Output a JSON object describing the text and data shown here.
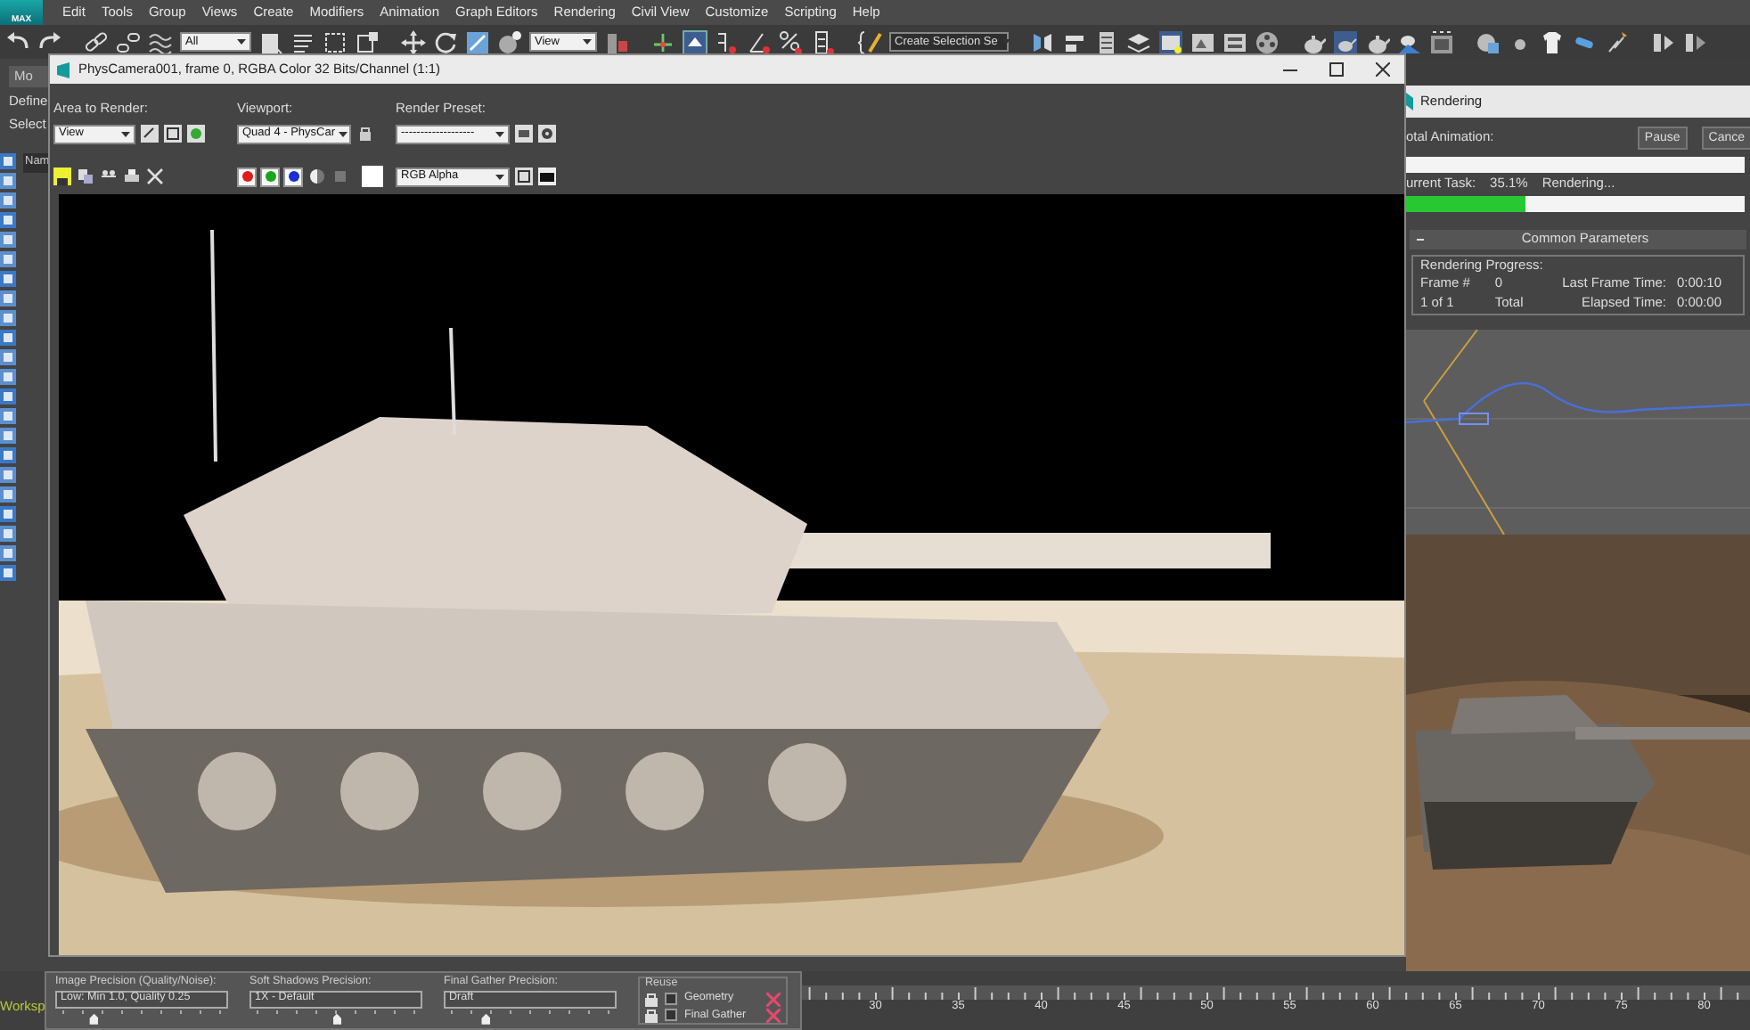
{
  "menu": {
    "logo": "MAX",
    "items": [
      "Edit",
      "Tools",
      "Group",
      "Views",
      "Create",
      "Modifiers",
      "Animation",
      "Graph Editors",
      "Rendering",
      "Civil View",
      "Customize",
      "Scripting",
      "Help"
    ]
  },
  "toolbar": {
    "dropdowns": [
      "All",
      "View",
      "Create Selection Se"
    ]
  },
  "command_panel": {
    "tab": "Mo",
    "rows": [
      "Define",
      "Select"
    ],
    "name_field": "Nam"
  },
  "frame_window": {
    "title": "PhysCamera001, frame 0, RGBA Color 32 Bits/Channel (1:1)",
    "area_label": "Area to Render:",
    "area_value": "View",
    "viewport_label": "Viewport:",
    "viewport_value": "Quad 4 - PhysCar",
    "preset_label": "Render Preset:",
    "preset_value": "-------------------",
    "channels": [
      {
        "color": "#e01b1b",
        "on": true
      },
      {
        "color": "#1aa51a",
        "on": true
      },
      {
        "color": "#1c2fd6",
        "on": true
      }
    ],
    "display_value": "RGB Alpha"
  },
  "rendering_dialog": {
    "title": "Rendering",
    "total_label": "otal Animation:",
    "buttons": [
      "Pause",
      "Cance"
    ],
    "total_progress": {
      "level": 0
    },
    "task_label": "urrent Task:",
    "task_percent": "35.1%",
    "task_status": "Rendering...",
    "task_progress": {
      "level": 0.35
    },
    "rollout": "Common Parameters",
    "group": "Rendering Progress:",
    "frame_label": "Frame #",
    "frame_value": "0",
    "frame_count": "1 of 1",
    "total": "Total",
    "last_frame_label": "Last Frame Time:",
    "last_frame_value": "0:00:10",
    "elapsed_label": "Elapsed Time:",
    "elapsed_value": "0:00:00"
  },
  "workspace_label": "Worksp",
  "render_settings": {
    "precisions": [
      {
        "label": "Image Precision (Quality/Noise):",
        "value": "Low: Min 1.0, Quality 0.25",
        "level": 0.22
      },
      {
        "label": "Soft Shadows Precision:",
        "value": "1X - Default",
        "level": 0.5
      },
      {
        "label": "Final Gather Precision:",
        "value": "Draft",
        "level": 0.24
      }
    ],
    "reuse": {
      "title": "Reuse",
      "items": [
        {
          "label": "Geometry",
          "checked": false
        },
        {
          "label": "Final Gather",
          "checked": false
        }
      ]
    }
  },
  "timeline": {
    "labels": [
      "30",
      "35",
      "40",
      "45",
      "50",
      "55",
      "60",
      "65",
      "70",
      "75",
      "80"
    ]
  }
}
